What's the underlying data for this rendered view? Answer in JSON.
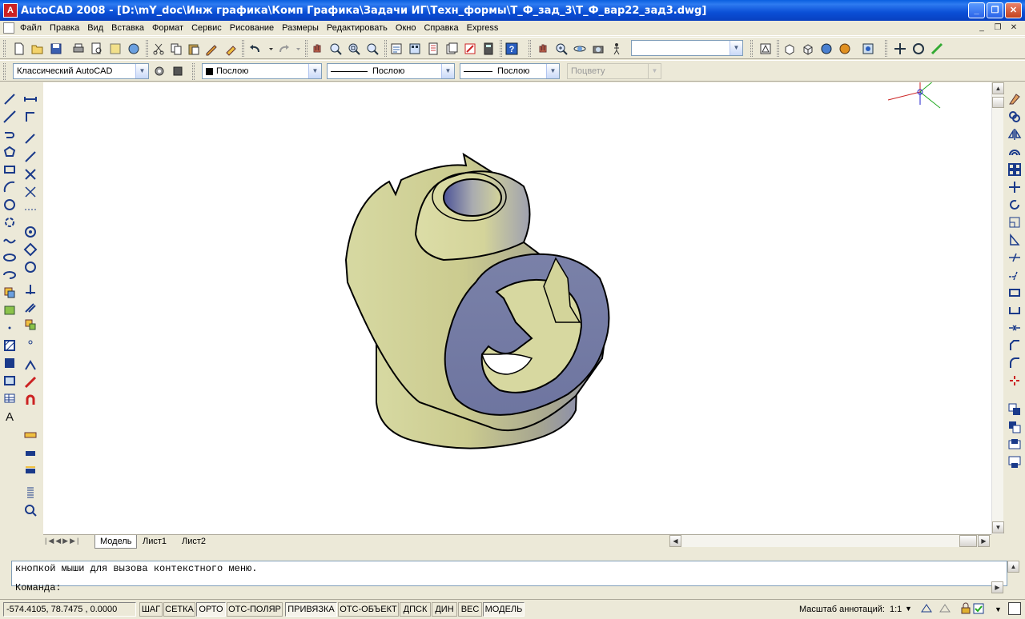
{
  "window": {
    "title": "AutoCAD 2008 - [D:\\mY_doc\\Инж графика\\Комп Графика\\Задачи ИГ\\Техн_формы\\Т_Ф_зад_3\\Т_Ф_вар22_зад3.dwg]"
  },
  "menu": {
    "items": [
      "Файл",
      "Правка",
      "Вид",
      "Вставка",
      "Формат",
      "Сервис",
      "Рисование",
      "Размеры",
      "Редактировать",
      "Окно",
      "Справка",
      "Express"
    ]
  },
  "toolbar2": {
    "workspace": "Классический AutoCAD",
    "color": "Послою",
    "linetype": "Послою",
    "lineweight": "Послою",
    "plotstyle": "Поцвету"
  },
  "layouts": {
    "tabs": [
      "Модель",
      "Лист1",
      "Лист2"
    ],
    "active": "Модель"
  },
  "command": {
    "line1": "кнопкой мыши для вызова контекстного меню.",
    "prompt": "Команда:"
  },
  "status": {
    "coords": "-574.4105, 78.7475 , 0.0000",
    "toggles": [
      "ШАГ",
      "СЕТКА",
      "ОРТО",
      "ОТС-ПОЛЯР",
      "ПРИВЯЗКА",
      "ОТС-ОБЪЕКТ",
      "ДПСК",
      "ДИН",
      "ВЕС",
      "МОДЕЛЬ"
    ],
    "pressed": [
      "ОРТО",
      "ПРИВЯЗКА",
      "МОДЕЛЬ"
    ],
    "annotation_scale_label": "Масштаб аннотаций:",
    "annotation_scale_value": "1:1"
  },
  "colors": {
    "title_blue": "#0A4FD6",
    "face_yellow": "#D9DA9A",
    "face_blue": "#6F77A3"
  },
  "icons": [
    "app-icon",
    "new-icon",
    "open-icon",
    "save-icon",
    "print-icon",
    "preview-icon",
    "publish-icon",
    "3d-dwf-icon",
    "cut-icon",
    "copy-icon",
    "paste-icon",
    "matchprop-icon",
    "undo-icon",
    "redo-icon",
    "pan-icon",
    "zoom-realtime-icon",
    "zoom-window-icon",
    "zoom-previous-icon",
    "properties-icon",
    "designcenter-icon",
    "toolpalettes-icon",
    "sheetset-icon",
    "markup-icon",
    "calculator-icon",
    "help-icon",
    "line-icon",
    "polygon-icon",
    "rectangle-icon",
    "arc-icon",
    "circle-icon",
    "hatch-icon",
    "text-icon"
  ]
}
